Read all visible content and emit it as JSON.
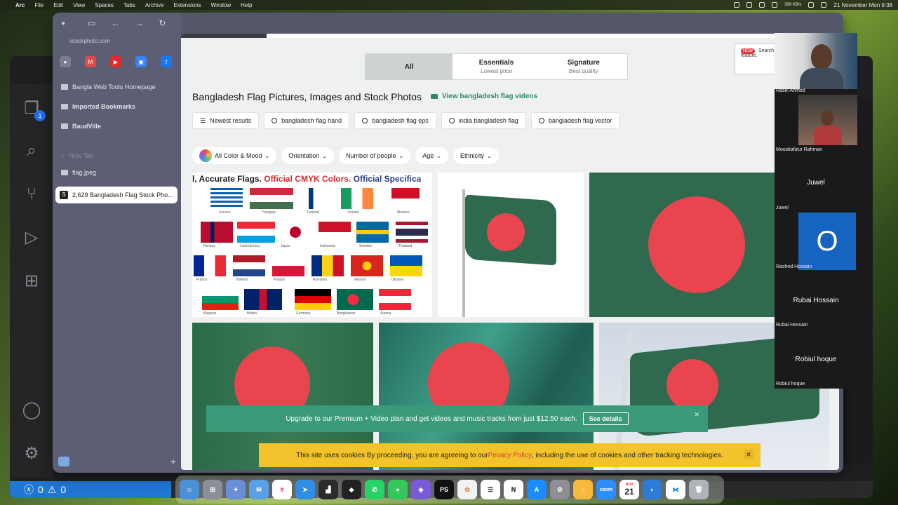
{
  "menubar": {
    "app": "Arc",
    "items": [
      "File",
      "Edit",
      "View",
      "Spaces",
      "Tabs",
      "Archive",
      "Extensions",
      "Window",
      "Help"
    ],
    "net_speed": "389 KB/s",
    "datetime": "21 November Mon 9:38"
  },
  "arc": {
    "url": "istockphoto.com",
    "sidebar_items": [
      "Bangla Web Tools Homepage",
      "Imported Bookmarks",
      "BaudVille"
    ],
    "new_tab": "New Tab",
    "file_item": "flag.jpeg",
    "active_tab": "2,629 Bangladesh Flag Stock Pho..."
  },
  "page": {
    "segments": [
      {
        "label": "All",
        "sub": ""
      },
      {
        "label": "Essentials",
        "sub": "Lowest price"
      },
      {
        "label": "Signature",
        "sub": "Best quality"
      }
    ],
    "promo": {
      "badge": "NEW",
      "text": "Search has been upg new feature."
    },
    "title": "Bangladesh Flag Pictures, Images and Stock Photos",
    "video_link": "View bangladesh flag videos",
    "chips": [
      "Newest results",
      "bangladesh flag hand",
      "bangladesh flag eps",
      "india bangladesh flag",
      "bangladesh flag vector"
    ],
    "filters": [
      "All Color & Mood",
      "Orientation",
      "Number of people",
      "Age",
      "Ethnicity"
    ],
    "cmyk_heading": {
      "part1": "l, Accurate Flags. ",
      "part2": "Official CMYK Colors. ",
      "part3": "Official Specifica"
    },
    "flag_labels": [
      "Greece",
      "Hungary",
      "Finland",
      "Ireland",
      "Monaco",
      "Norway",
      "Luxembourg",
      "Japan",
      "Indonesia",
      "Sweden",
      "Thailand",
      "France",
      "Holland",
      "Poland",
      "Romania",
      "Vietnam",
      "Ukraine",
      "Bulgaria",
      "Britain",
      "Germany",
      "Bangladesh",
      "Austria"
    ],
    "upgrade_text": "Upgrade to our Premium + Video plan and get videos and music tracks from just $12.50 each.",
    "upgrade_btn": "See details",
    "cookie_text_1": "This site uses cookies By proceeding, you are agreeing to our ",
    "cookie_link": "Privacy Policy",
    "cookie_text_2": ", including the use of cookies and other tracking technologies."
  },
  "call": {
    "participants": [
      "Rasel Ahmed",
      "Moustiafizur Rahman",
      "Juwel",
      "Rashed Hossain",
      "Rubai Hossain",
      "Robiul hoque"
    ],
    "avatar_letter": "O"
  },
  "vscode": {
    "badge": "1",
    "errors": "0",
    "warnings": "0"
  },
  "dock": {
    "calendar_month": "NOV",
    "calendar_day": "21"
  }
}
